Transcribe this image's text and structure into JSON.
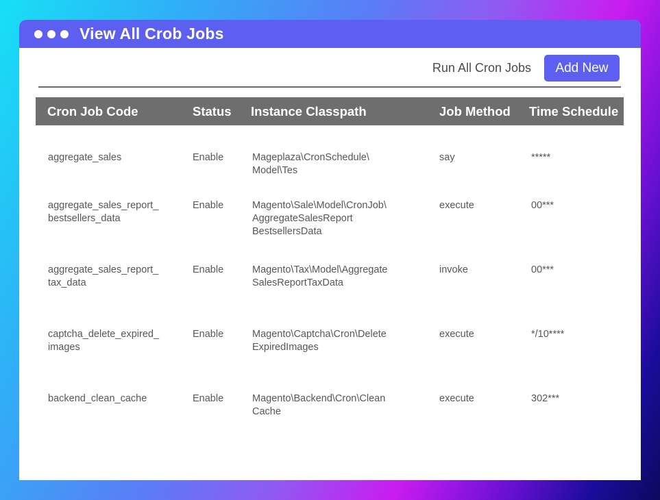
{
  "window": {
    "title": "View All Crob Jobs"
  },
  "toolbar": {
    "run_all_label": "Run All Cron Jobs",
    "add_new_label": "Add New"
  },
  "table": {
    "headers": [
      "Cron Job Code",
      "Status",
      "Instance Classpath",
      "Job Method",
      "Time Schedule"
    ],
    "rows": [
      {
        "code": [
          "aggregate_sales"
        ],
        "status": "Enable",
        "classpath": [
          "Mageplaza\\CronSchedule\\",
          "Model\\Tes"
        ],
        "method": "say",
        "schedule": "*****"
      },
      {
        "code": [
          "aggregate_sales_report_",
          "bestsellers_data"
        ],
        "status": "Enable",
        "classpath": [
          "Magento\\Sale\\Model\\CronJob\\",
          "AggregateSalesReport",
          "BestsellersData"
        ],
        "method": "execute",
        "schedule": "00***"
      },
      {
        "code": [
          "aggregate_sales_report_",
          "tax_data"
        ],
        "status": "Enable",
        "classpath": [
          "Magento\\Tax\\Model\\Aggregate",
          "SalesReportTaxData"
        ],
        "method": "invoke",
        "schedule": "00***"
      },
      {
        "code": [
          "captcha_delete_expired_",
          "images"
        ],
        "status": "Enable",
        "classpath": [
          "Magento\\Captcha\\Cron\\Delete",
          "ExpiredImages"
        ],
        "method": "execute",
        "schedule": "*/10****"
      },
      {
        "code": [
          "backend_clean_cache"
        ],
        "status": "Enable",
        "classpath": [
          "Magento\\Backend\\Cron\\Clean",
          "Cache"
        ],
        "method": "execute",
        "schedule": "302***"
      }
    ]
  }
}
